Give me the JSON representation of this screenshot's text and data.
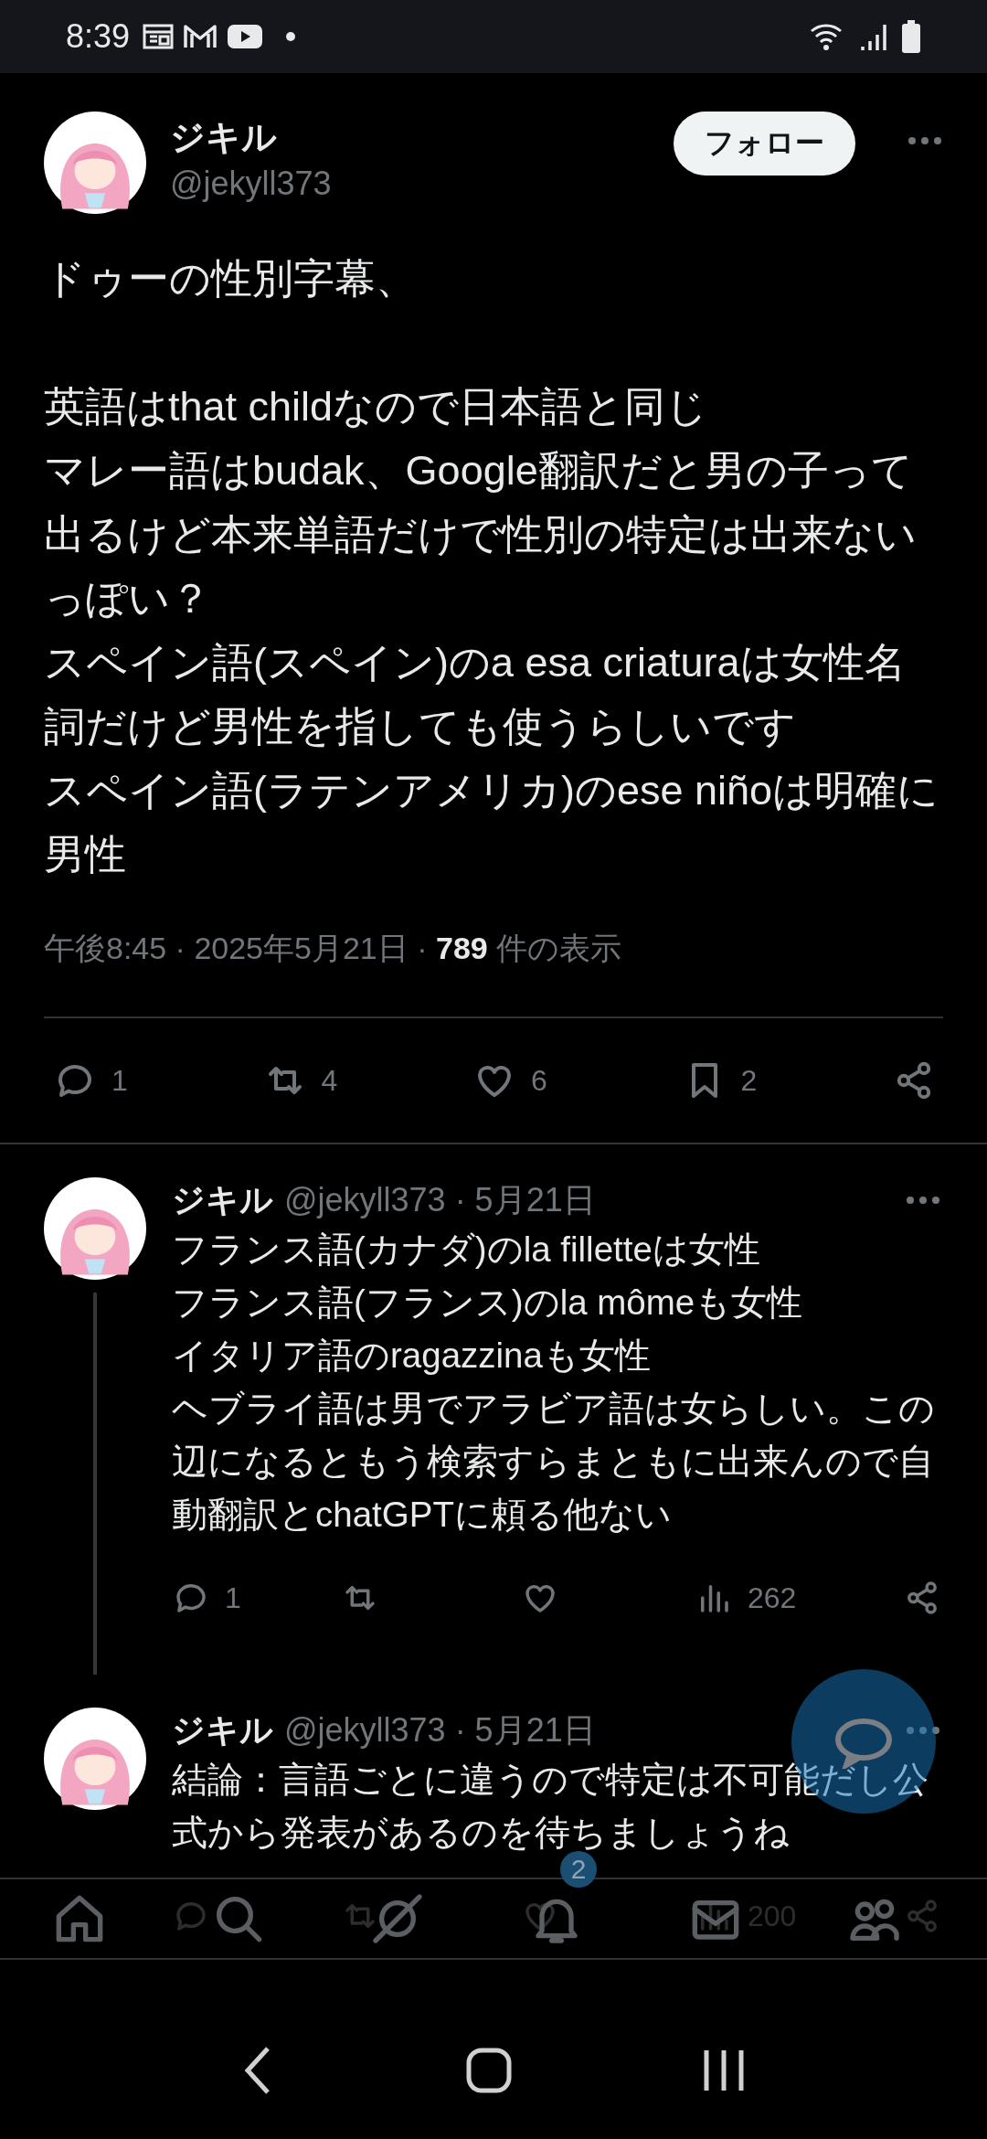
{
  "status_bar": {
    "time": "8:39"
  },
  "tweet": {
    "author": {
      "name": "ジキル",
      "handle": "@jekyll373"
    },
    "follow_button": "フォロー",
    "paragraphs": [
      [
        "ドゥーの性別字幕、"
      ],
      [
        "英語はthat childなので日本語と同じ",
        "マレー語はbudak、Google翻訳だと男の子って出るけど本来単語だけで性別の特定は出来ないっぽい？",
        "スペイン語(スペイン)のa esa criaturaは女性名詞だけど男性を指しても使うらしいです",
        "スペイン語(ラテンアメリカ)のese niñoは明確に男性"
      ]
    ],
    "meta": "午後8:45 · 2025年5月21日 · **789** 件の表示",
    "actions": [
      {
        "kind": "reply",
        "count": "1"
      },
      {
        "kind": "repost",
        "count": "4"
      },
      {
        "kind": "like",
        "count": "6"
      },
      {
        "kind": "bookmark",
        "count": "2"
      },
      {
        "kind": "share"
      }
    ]
  },
  "replies": [
    {
      "name": "ジキル",
      "meta": "@jekyll373 · 5月21日",
      "lines": [
        "フランス語(カナダ)のla filletteは女性",
        "フランス語(フランス)のla mômeも女性",
        "イタリア語のragazzinaも女性",
        "ヘブライ語は男でアラビア語は女らしい。この辺になるともう検索すらまともに出来んので自動翻訳とchatGPTに頼る他ない"
      ],
      "actions": [
        {
          "kind": "reply",
          "count": "1"
        },
        {
          "kind": "repost"
        },
        {
          "kind": "like"
        },
        {
          "kind": "views",
          "count": "262"
        },
        {
          "kind": "share"
        }
      ]
    },
    {
      "name": "ジキル",
      "meta": "@jekyll373 · 5月21日",
      "lines": [
        "結論：言語ごとに違うので特定は不可能だし公式から発表があるのを待ちましょうね"
      ],
      "actions": [
        {
          "kind": "reply"
        },
        {
          "kind": "repost"
        },
        {
          "kind": "like"
        },
        {
          "kind": "views",
          "count": "200"
        },
        {
          "kind": "share"
        }
      ]
    }
  ],
  "bottom_nav": [
    {
      "kind": "home"
    },
    {
      "kind": "search"
    },
    {
      "kind": "grok"
    },
    {
      "kind": "notifications",
      "badge": "2"
    },
    {
      "kind": "messages"
    },
    {
      "kind": "communities"
    }
  ]
}
